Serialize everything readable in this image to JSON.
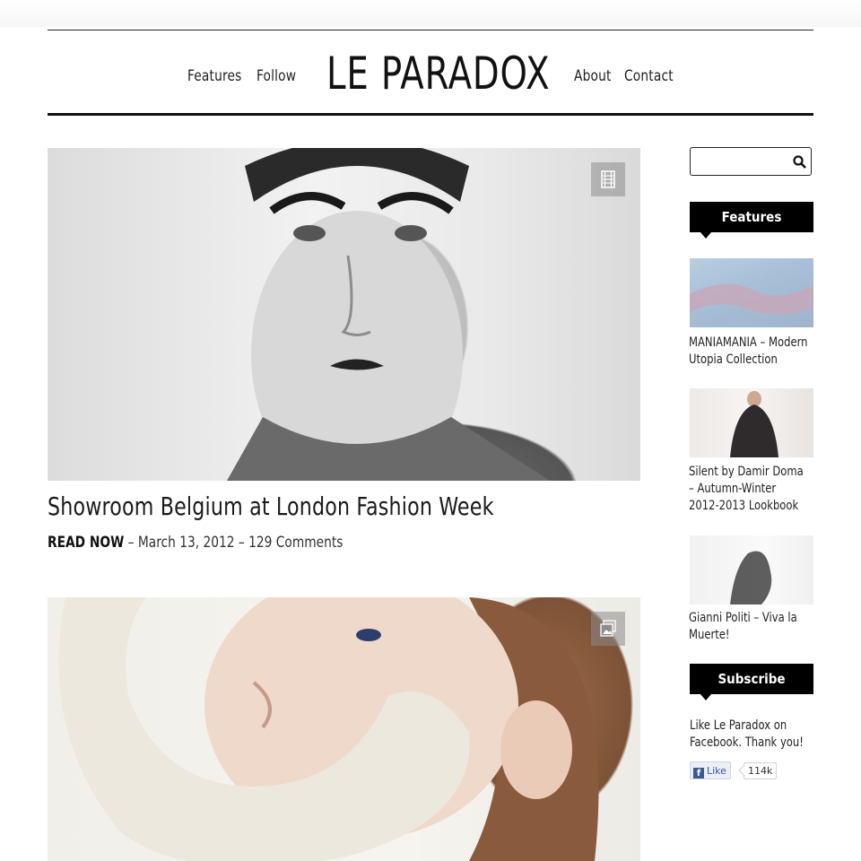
{
  "header": {
    "logo": "LE PARADOX",
    "nav_left": [
      "Features",
      "Follow"
    ],
    "nav_right": [
      "About",
      "Contact"
    ]
  },
  "posts": [
    {
      "title": "Showroom Belgium at London Fashion Week",
      "read_label": "READ NOW",
      "date": "March 13, 2012",
      "comments": "129 Comments",
      "badge_icon": "film-icon"
    },
    {
      "badge_icon": "gallery-icon"
    }
  ],
  "sidebar": {
    "search": {
      "value": "",
      "placeholder": ""
    },
    "features_heading": "Features",
    "features": [
      {
        "title": "MANIAMANIA – Modern Utopia Collection"
      },
      {
        "title": "Silent by Damir Doma – Autumn-Winter 2012-2013 Lookbook"
      },
      {
        "title": "Gianni Politi – Viva la Muerte!"
      }
    ],
    "subscribe_heading": "Subscribe",
    "subscribe_text": "Like Le Paradox on Facebook. Thank you!",
    "facebook": {
      "like_label": "Like",
      "count": "114k"
    }
  },
  "colors": {
    "text": "#1a1a1a",
    "heading_bg": "#000000",
    "facebook_blue": "#3b5998"
  }
}
